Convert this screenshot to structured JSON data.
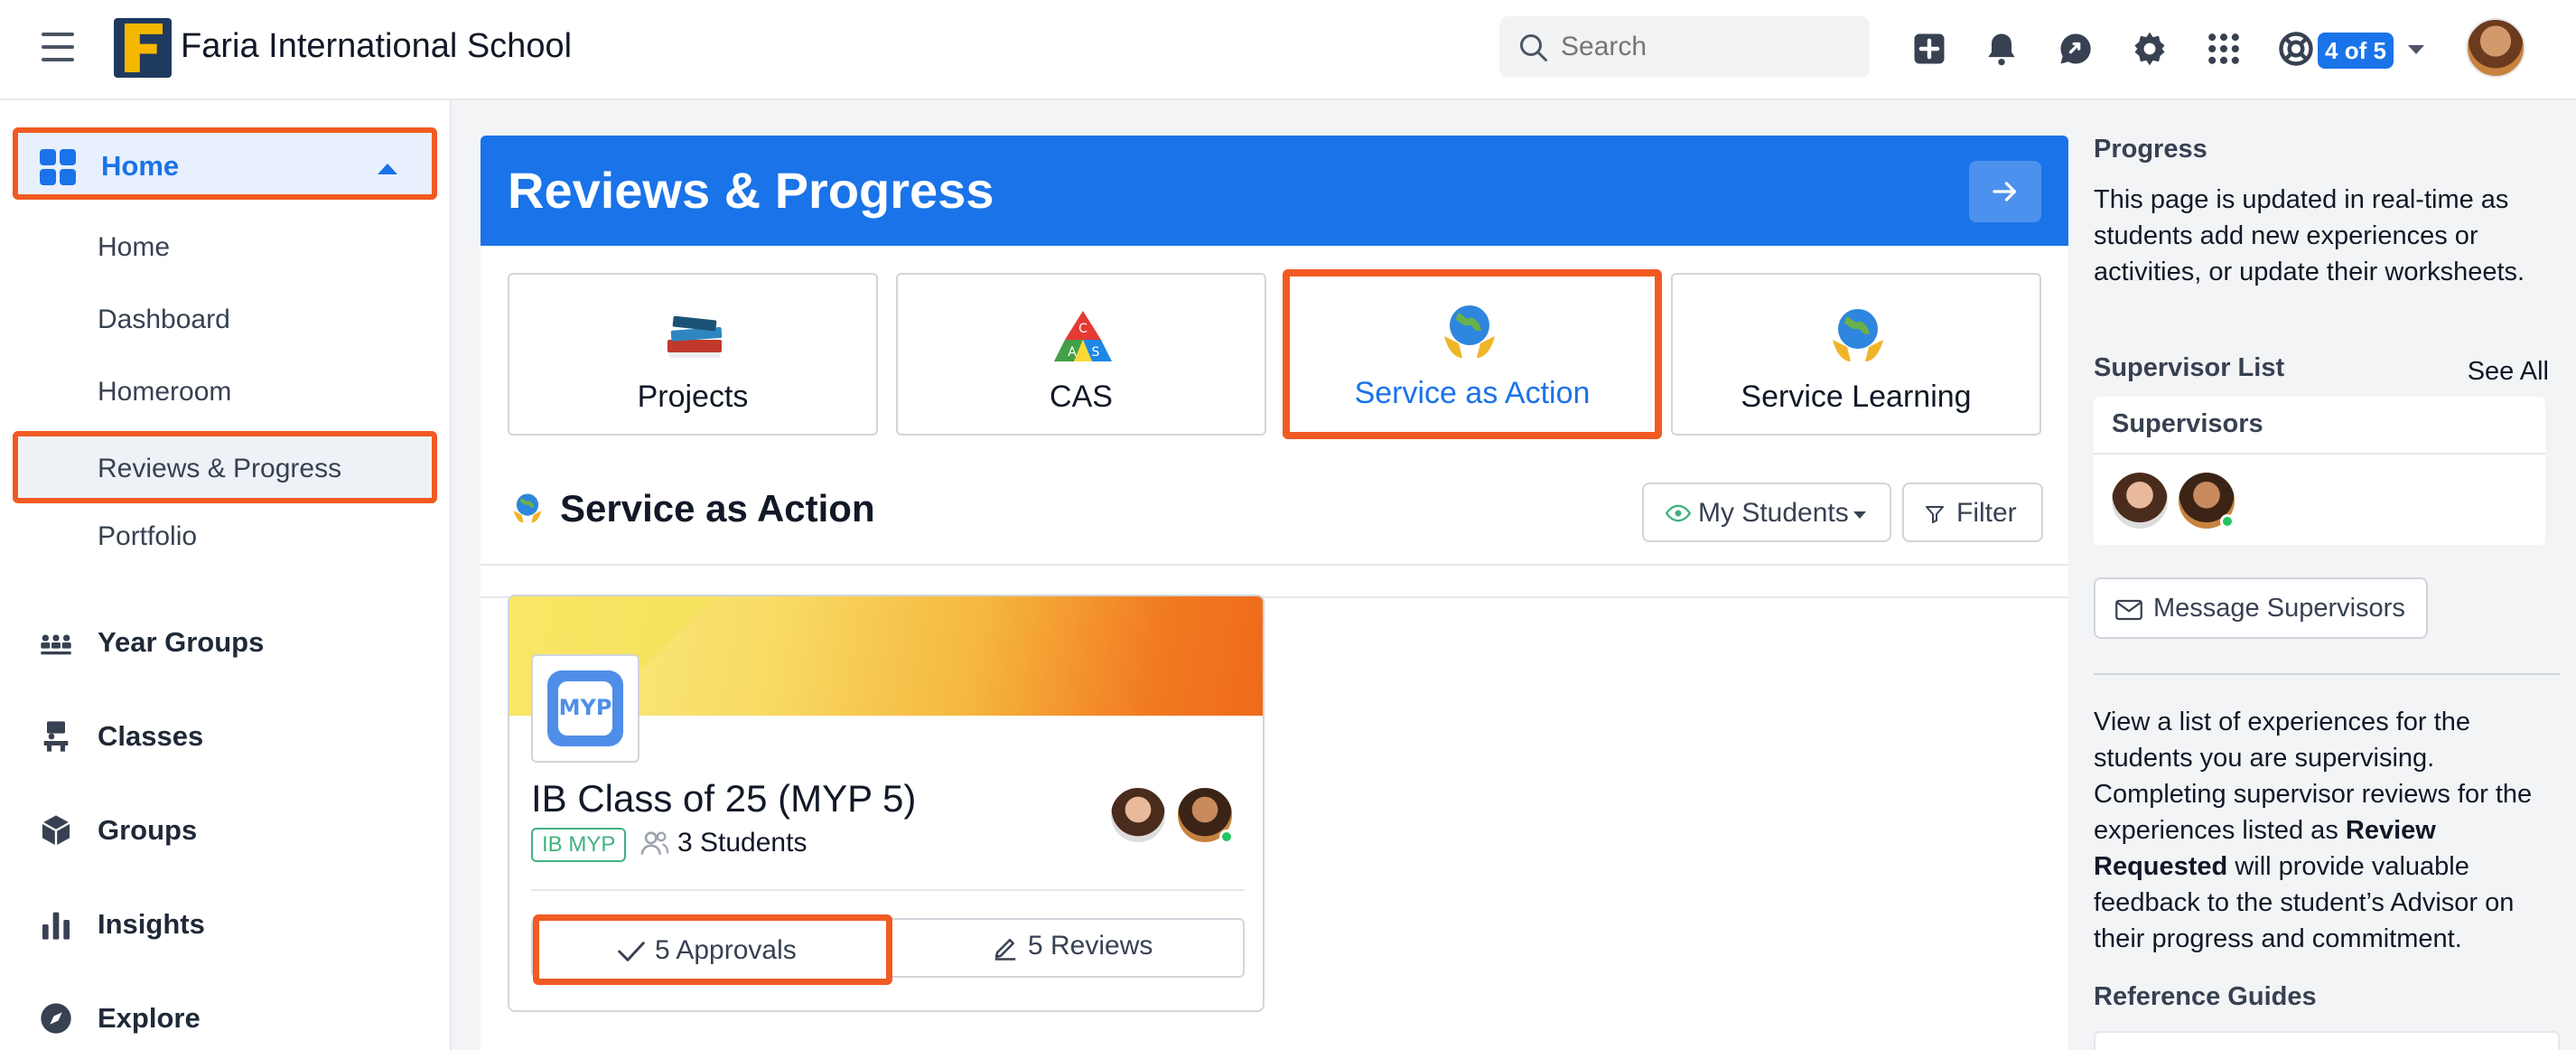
{
  "header": {
    "school_name": "Faria International School",
    "search_placeholder": "Search",
    "progress_badge": "4 of 5"
  },
  "sidebar": {
    "home_label": "Home",
    "sub_items": [
      "Home",
      "Dashboard",
      "Homeroom",
      "Reviews & Progress",
      "Portfolio"
    ],
    "items": [
      "Year Groups",
      "Classes",
      "Groups",
      "Insights",
      "Explore"
    ]
  },
  "main": {
    "title": "Reviews & Progress",
    "tabs": [
      {
        "label": "Projects",
        "icon": "books-icon"
      },
      {
        "label": "CAS",
        "icon": "cas-triangle-icon"
      },
      {
        "label": "Service as Action",
        "icon": "globe-hands-icon",
        "active": true
      },
      {
        "label": "Service Learning",
        "icon": "globe-hands-icon"
      }
    ],
    "section_title": "Service as Action",
    "my_students_label": "My Students",
    "filter_label": "Filter",
    "card": {
      "title": "IB Class of 25 (MYP 5)",
      "tag": "IB MYP",
      "logo_text": "MYP",
      "students": "3 Students",
      "approvals": "5 Approvals",
      "reviews": "5 Reviews"
    }
  },
  "right_panel": {
    "progress_heading": "Progress",
    "progress_text": "This page is updated in real-time as students add new experiences or activities, or update their worksheets.",
    "supervisor_list_heading": "Supervisor List",
    "see_all": "See All",
    "supervisors_heading": "Supervisors",
    "message_button": "Message Supervisors",
    "info_text_1": "View a list of experiences for the students you are supervising. Completing supervisor reviews for the experiences listed as ",
    "info_text_bold": "Review Requested",
    "info_text_2": " will provide valuable feedback to the student’s Advisor on their progress and commitment.",
    "reference_heading": "Reference Guides"
  },
  "colors": {
    "accent": "#1a73e8",
    "highlight": "#f15a22",
    "tag_green": "#3fb27f"
  }
}
